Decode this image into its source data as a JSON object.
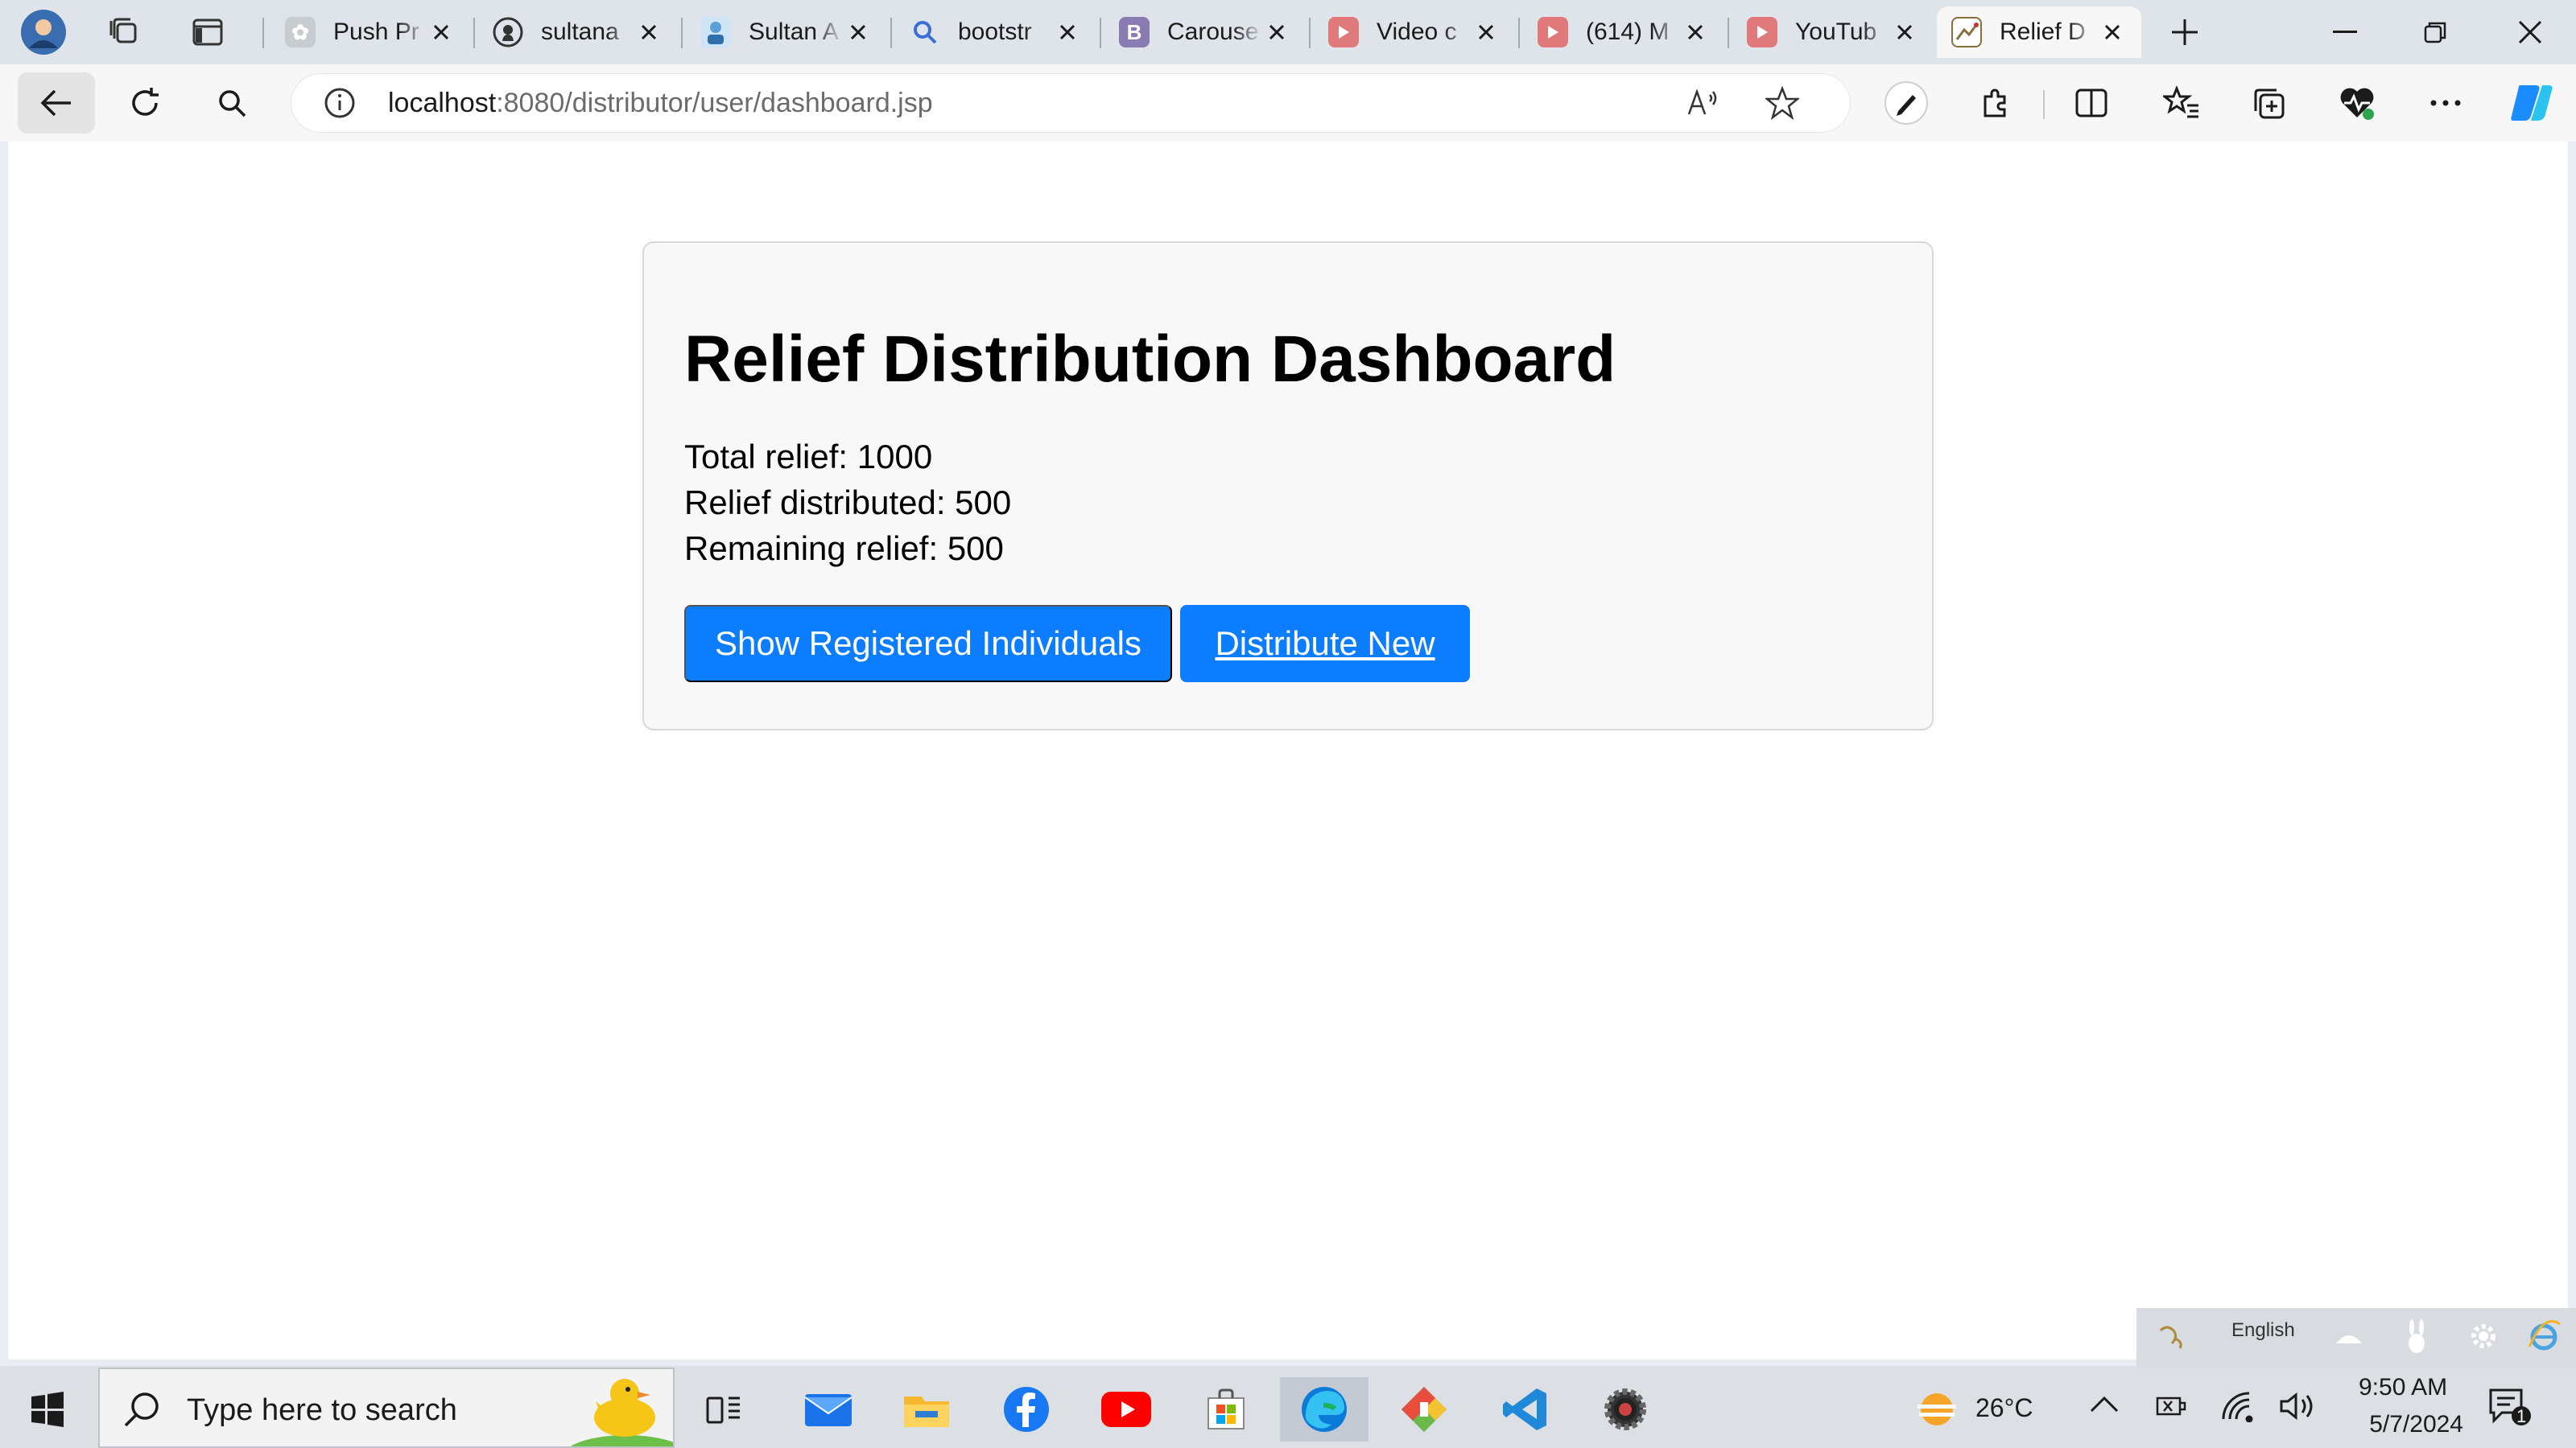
{
  "browser": {
    "tabs": [
      {
        "title": "Push Pr",
        "icon": "chatgpt-icon",
        "color": "#c7cccf"
      },
      {
        "title": "sultana",
        "icon": "github-icon",
        "color": "#24292f"
      },
      {
        "title": "Sultan A",
        "icon": "profile-icon",
        "color": "#5aa0d8"
      },
      {
        "title": "bootstr",
        "icon": "search-icon",
        "color": "#3b6fd6"
      },
      {
        "title": "Carouse",
        "icon": "bootstrap-icon",
        "color": "#8a7bb3"
      },
      {
        "title": "Video c",
        "icon": "youtube-icon",
        "color": "#e07a7a"
      },
      {
        "title": "(614) M",
        "icon": "youtube-icon",
        "color": "#e07a7a"
      },
      {
        "title": "YouTub",
        "icon": "youtube-icon",
        "color": "#e07a7a"
      },
      {
        "title": "Relief D",
        "icon": "relief-favicon",
        "color": "#8a6d3b",
        "active": true
      }
    ],
    "url_host": "localhost",
    "url_path": ":8080/distributor/user/dashboard.jsp"
  },
  "page": {
    "title": "Relief Distribution Dashboard",
    "stats": [
      "Total relief: 1000",
      "Relief distributed: 500",
      "Remaining relief: 500"
    ],
    "buttons": {
      "show_registered": "Show Registered Individuals",
      "distribute_new": "Distribute New"
    }
  },
  "language_bar": {
    "language": "English"
  },
  "taskbar": {
    "search_placeholder": "Type here to search",
    "weather": "26°C",
    "time": "9:50 AM",
    "date": "5/7/2024",
    "notification_count": "1"
  },
  "colors": {
    "accent": "#0b7dfe",
    "card_bg": "#f8f8f8"
  }
}
